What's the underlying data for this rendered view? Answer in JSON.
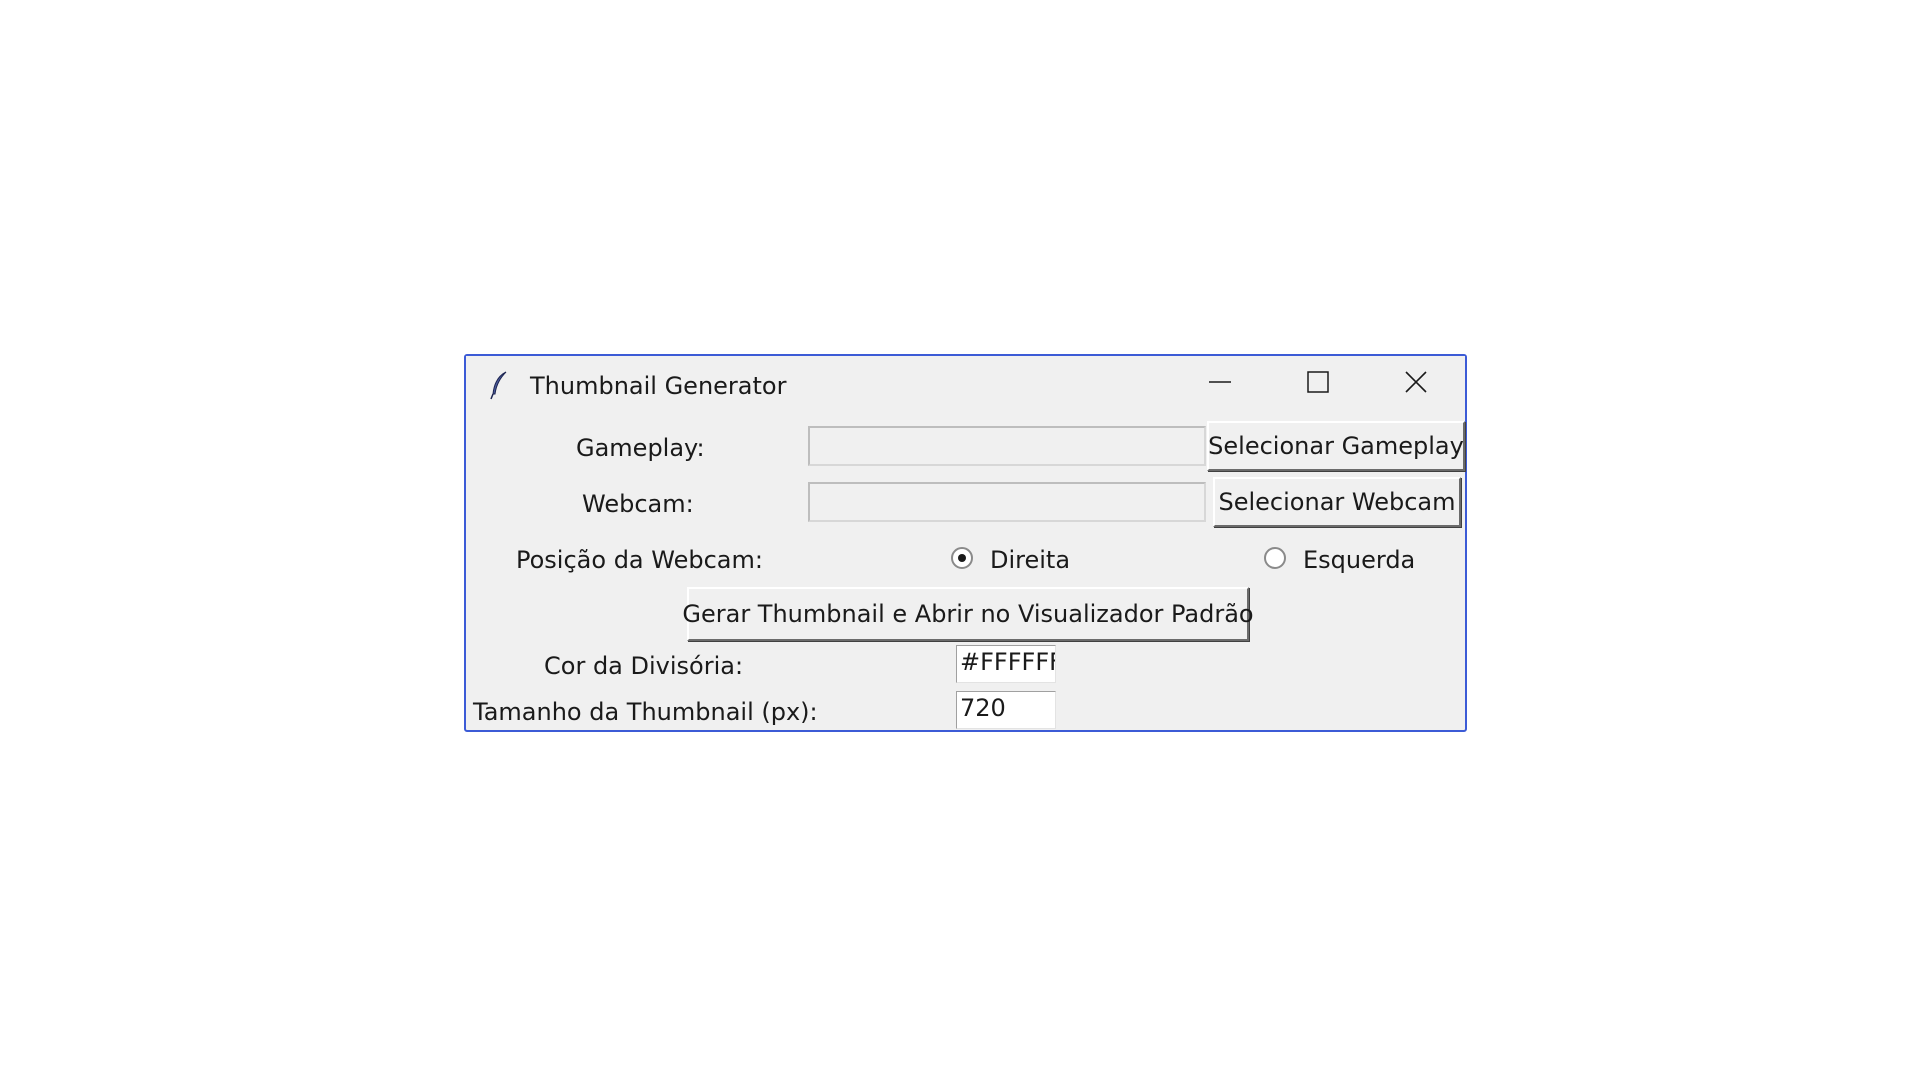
{
  "window": {
    "title": "Thumbnail Generator",
    "icon": "feather-icon",
    "controls": [
      "minimize-icon",
      "maximize-icon",
      "close-icon"
    ]
  },
  "form": {
    "gameplay": {
      "label": "Gameplay:",
      "value": "",
      "button_label": "Selecionar Gameplay"
    },
    "webcam": {
      "label": "Webcam:",
      "value": "",
      "button_label": "Selecionar Webcam"
    },
    "position": {
      "label": "Posição da Webcam:",
      "options": [
        {
          "label": "Direita",
          "selected": true
        },
        {
          "label": "Esquerda",
          "selected": false
        }
      ]
    },
    "generate_button_label": "Gerar Thumbnail e Abrir no Visualizador Padrão",
    "divider_color": {
      "label": "Cor da Divisória:",
      "value": "#FFFFFF"
    },
    "thumbnail_size": {
      "label": "Tamanho da Thumbnail (px):",
      "value": "720"
    }
  }
}
